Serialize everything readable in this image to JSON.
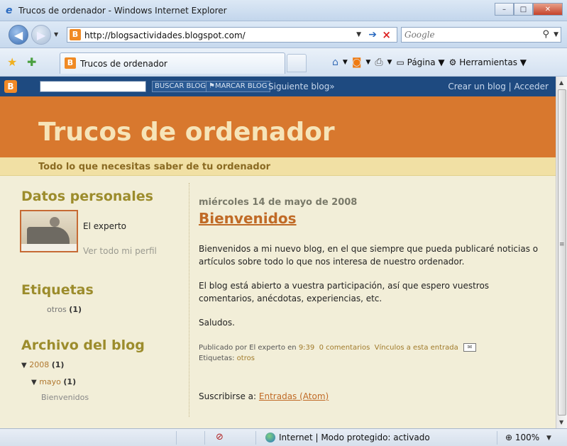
{
  "window": {
    "title": "Trucos de ordenador - Windows Internet Explorer",
    "minimize": "–",
    "maximize": "□",
    "close": "✕"
  },
  "address": {
    "url": "http://blogsactividades.blogspot.com/",
    "search_placeholder": "Google"
  },
  "tab": {
    "title": "Trucos de ordenador"
  },
  "commandbar": {
    "page_label": "Página",
    "tools_label": "Herramientas"
  },
  "blogger_navbar": {
    "search_button": "BUSCAR BLOG",
    "flag_button": "⚑MARCAR BLOG",
    "next_blog": "Siguiente blog»",
    "create_signin": "Crear un blog | Acceder"
  },
  "blog": {
    "title": "Trucos de ordenador",
    "description": "Todo lo que necesitas saber de tu ordenador"
  },
  "sidebar": {
    "profile_heading": "Datos personales",
    "profile_name": "El experto",
    "profile_link": "Ver todo mi perfil",
    "labels_heading": "Etiquetas",
    "label_name": "otros",
    "label_count": "(1)",
    "archive_heading": "Archivo del blog",
    "archive_year": "2008",
    "archive_year_count": "(1)",
    "archive_month": "mayo",
    "archive_month_count": "(1)",
    "archive_post": "Bienvenidos"
  },
  "post": {
    "date": "miércoles 14 de mayo de 2008",
    "title": "Bienvenidos",
    "p1": "Bienvenidos a mi nuevo blog, en el que siempre que pueda publicaré noticias o artículos sobre todo lo que nos interesa de nuestro ordenador.",
    "p2": "El blog está abierto a vuestra participación, así que espero vuestros comentarios, anécdotas, experiencias, etc.",
    "p3": "Saludos.",
    "footer_prefix": "Publicado por El experto en",
    "time": "9:39",
    "comments": "0 comentarios",
    "links": "Vínculos a esta entrada",
    "labels_prefix": "Etiquetas:",
    "label": "otros"
  },
  "subscribe": {
    "prefix": "Suscribirse a:",
    "link": "Entradas (Atom)"
  },
  "status": {
    "zone": "Internet | Modo protegido: activado",
    "zoom": "100%"
  }
}
